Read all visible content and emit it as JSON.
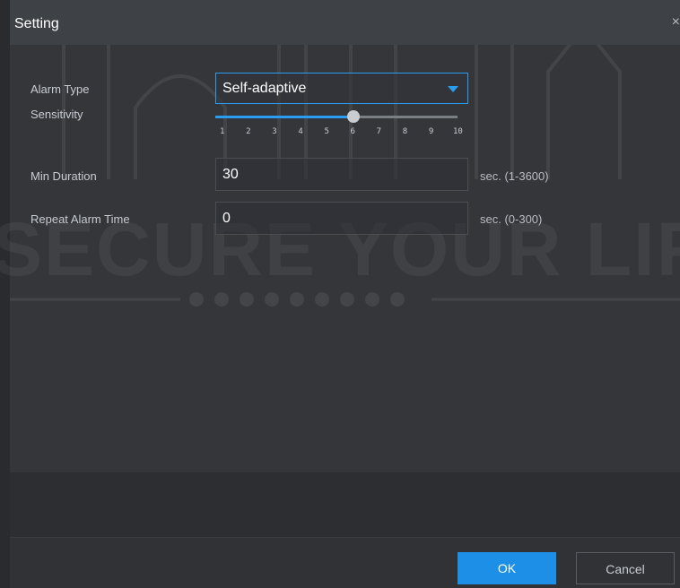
{
  "dialog": {
    "title": "Setting",
    "close_icon": "close-icon",
    "close_glyph": "×"
  },
  "form": {
    "alarm_type": {
      "label": "Alarm Type",
      "value": "Self-adaptive",
      "icon": "chevron-down-icon"
    },
    "sensitivity": {
      "label": "Sensitivity",
      "value": 6,
      "min": 1,
      "max": 10,
      "ticks": [
        "1",
        "2",
        "3",
        "4",
        "5",
        "6",
        "7",
        "8",
        "9",
        "10"
      ]
    },
    "min_duration": {
      "label": "Min Duration",
      "value": "30",
      "unit": "sec. (1-3600)"
    },
    "repeat_alarm_time": {
      "label": "Repeat Alarm Time",
      "value": "0",
      "unit": "sec. (0-300)"
    }
  },
  "footer": {
    "ok_label": "OK",
    "cancel_label": "Cancel"
  },
  "watermark": {
    "text": "SECURE YOUR LIFE"
  },
  "colors": {
    "accent": "#1e8fe6",
    "background": "#34363a",
    "title_bar": "#3e4145"
  }
}
